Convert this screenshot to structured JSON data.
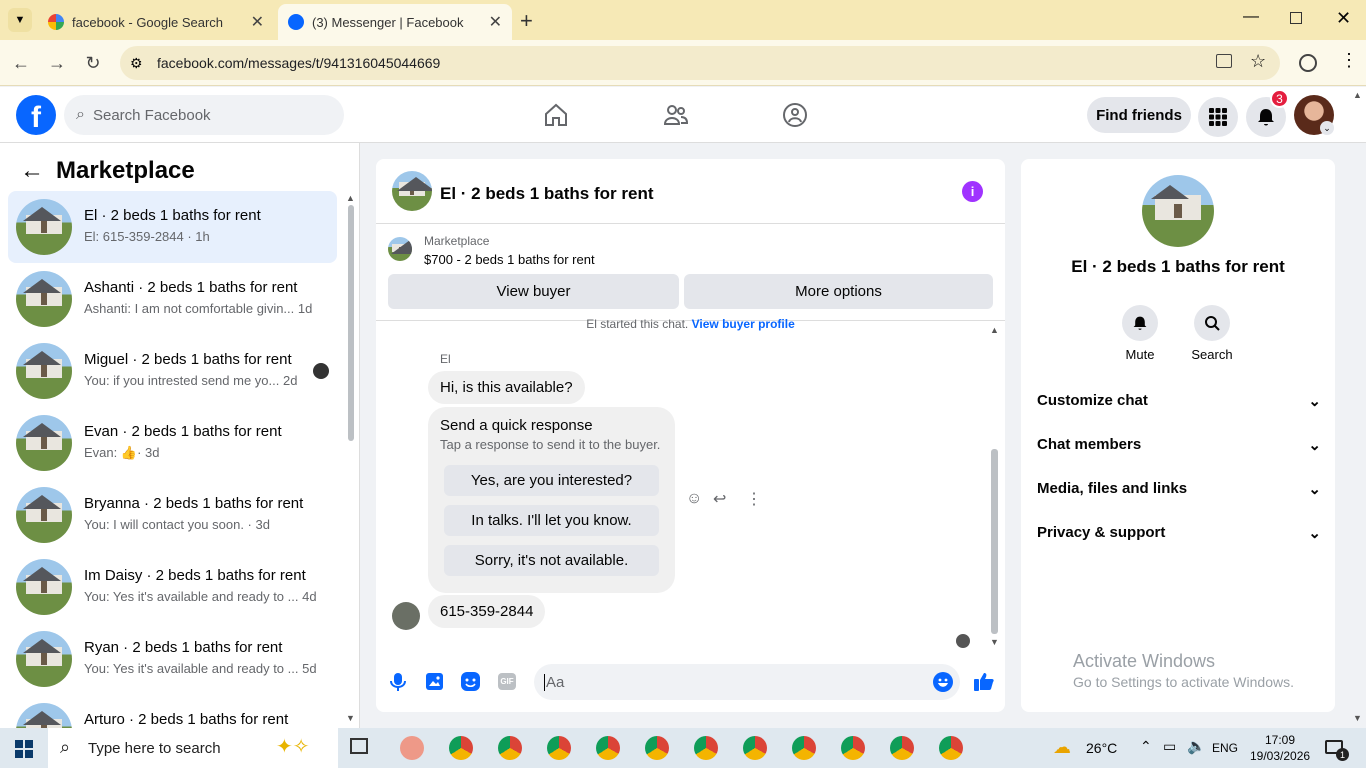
{
  "browser": {
    "tabs": [
      {
        "title": "facebook - Google Search",
        "active": false
      },
      {
        "title": "(3) Messenger | Facebook",
        "active": true
      }
    ],
    "url": "facebook.com/messages/t/941316045044669"
  },
  "header": {
    "search_placeholder": "Search Facebook",
    "find_friends": "Find friends",
    "notif_count": "3"
  },
  "sidebar": {
    "title": "Marketplace",
    "conversations": [
      {
        "name": "El · 2 beds 1 baths for rent",
        "preview": "El: 615-359-2844 · 1h",
        "selected": true
      },
      {
        "name": "Ashanti · 2 beds 1 baths for rent",
        "preview": "Ashanti: I am not comfortable givin...",
        "time": "1d"
      },
      {
        "name": "Miguel · 2 beds 1 baths for rent",
        "preview": "You: if you intrested send me yo...",
        "time": "2d"
      },
      {
        "name": "Evan · 2 beds 1 baths for rent",
        "preview": "Evan:",
        "time": "· 3d"
      },
      {
        "name": "Bryanna · 2 beds 1 baths for rent",
        "preview": "You: I will contact you soon. · 3d"
      },
      {
        "name": "Im Daisy · 2 beds 1 baths for rent",
        "preview": "You: Yes it's available and ready to ...",
        "time": "4d"
      },
      {
        "name": "Ryan · 2 beds 1 baths for rent",
        "preview": "You: Yes it's available and ready to ...",
        "time": "5d"
      },
      {
        "name": "Arturo · 2 beds 1 baths for rent",
        "preview": ""
      }
    ]
  },
  "chat": {
    "title": "El · 2 beds 1 baths for rent",
    "listing_label": "Marketplace",
    "listing_price": "$700 - 2 beds 1 baths for rent",
    "view_buyer": "View buyer",
    "more_options": "More options",
    "started_text": "El started this chat.",
    "view_profile": "View buyer profile",
    "sender": "El",
    "msg1": "Hi, is this available?",
    "quick_title": "Send a quick response",
    "quick_sub": "Tap a response to send it to the buyer.",
    "quick_responses": [
      "Yes, are you interested?",
      "In talks. I'll let you know.",
      "Sorry, it's not available."
    ],
    "msg2": "615-359-2844",
    "composer_placeholder": "Aa"
  },
  "details": {
    "title": "El · 2 beds 1 baths for rent",
    "mute": "Mute",
    "search": "Search",
    "sections": [
      "Customize chat",
      "Chat members",
      "Media, files and links",
      "Privacy & support"
    ],
    "watermark_title": "Activate Windows",
    "watermark_sub": "Go to Settings to activate Windows."
  },
  "taskbar": {
    "search_placeholder": "Type here to search",
    "weather": "26°C",
    "lang": "ENG",
    "time": "17:09",
    "date": "19/03/2026",
    "notif": "1"
  }
}
